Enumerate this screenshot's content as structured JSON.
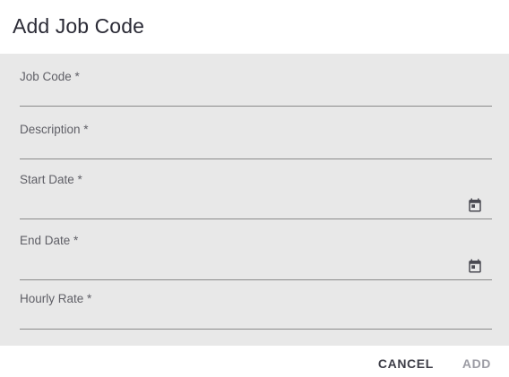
{
  "dialog": {
    "title": "Add Job Code"
  },
  "fields": {
    "job_code": {
      "label": "Job Code *",
      "value": ""
    },
    "description": {
      "label": "Description *",
      "value": ""
    },
    "start_date": {
      "label": "Start Date *",
      "value": "",
      "icon": "calendar-icon"
    },
    "end_date": {
      "label": "End Date *",
      "value": "",
      "icon": "calendar-icon"
    },
    "hourly_rate": {
      "label": "Hourly Rate *",
      "value": ""
    }
  },
  "actions": {
    "cancel_label": "CANCEL",
    "add_label": "ADD"
  },
  "colors": {
    "form_background": "#e8e8e8",
    "primary_text": "#2b2b36",
    "disabled_button": "#9c9ca4"
  }
}
